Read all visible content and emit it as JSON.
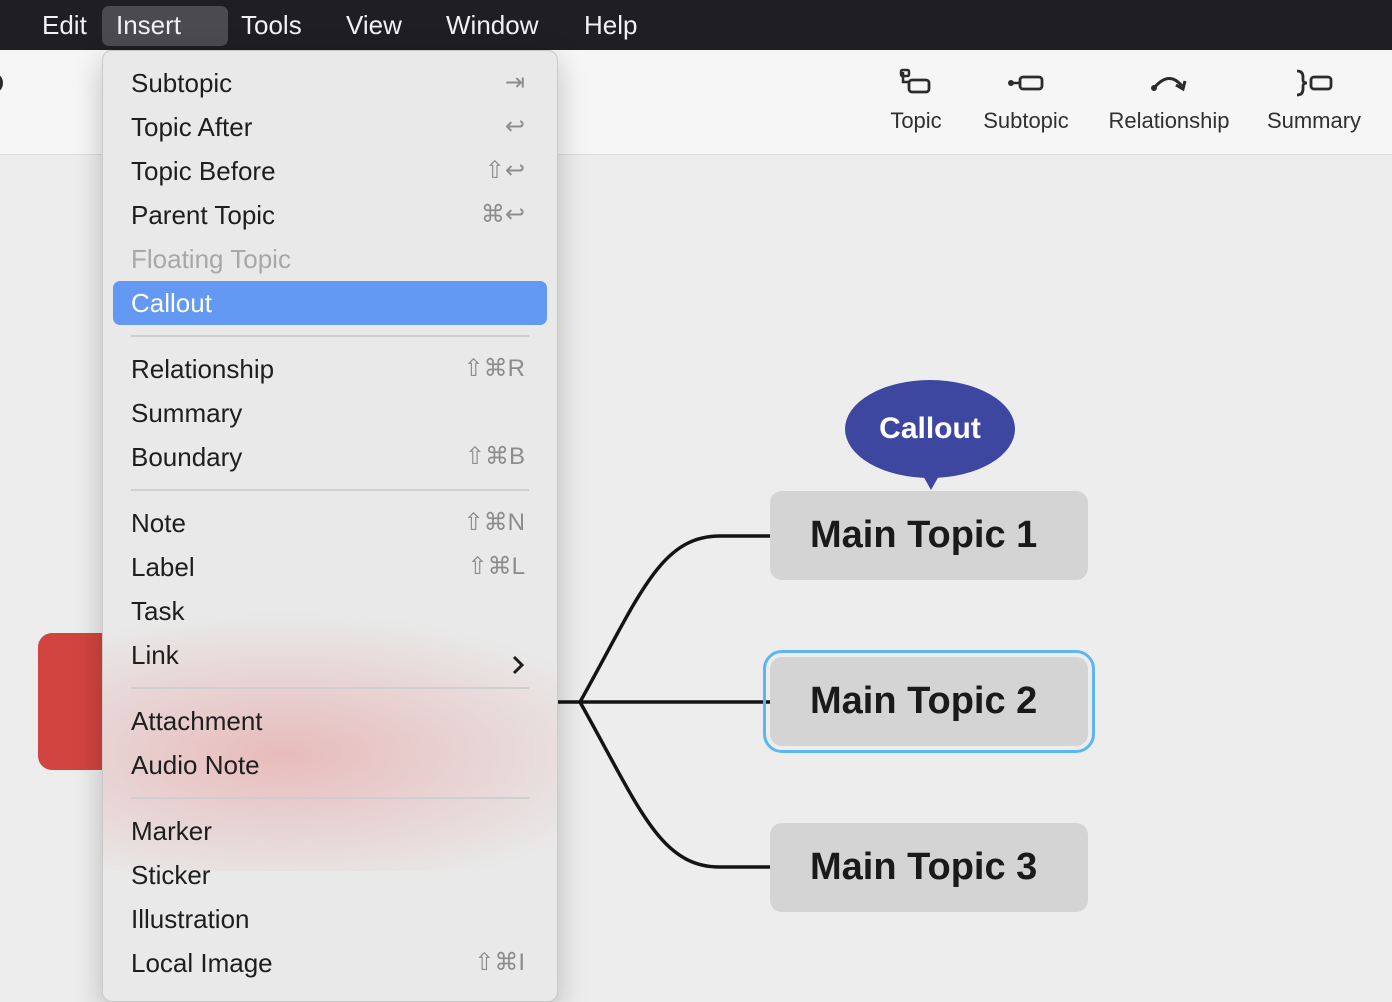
{
  "menubar": {
    "items": [
      {
        "label": "Edit",
        "active": false
      },
      {
        "label": "Insert",
        "active": true
      },
      {
        "label": "Tools",
        "active": false
      },
      {
        "label": "View",
        "active": false
      },
      {
        "label": "Window",
        "active": false
      },
      {
        "label": "Help",
        "active": false
      }
    ]
  },
  "toolbar": {
    "buttons": [
      {
        "label": "Topic",
        "icon": "insert-topic-icon"
      },
      {
        "label": "Subtopic",
        "icon": "insert-subtopic-icon"
      },
      {
        "label": "Relationship",
        "icon": "relationship-curve-icon"
      },
      {
        "label": "Summary",
        "icon": "summary-brace-icon"
      }
    ]
  },
  "insert_menu": {
    "items": [
      {
        "label": "Subtopic",
        "shortcut": "⇥"
      },
      {
        "label": "Topic After",
        "shortcut": "↩"
      },
      {
        "label": "Topic Before",
        "shortcut": "⇧↩"
      },
      {
        "label": "Parent Topic",
        "shortcut": "⌘↩"
      },
      {
        "label": "Floating Topic",
        "shortcut": "",
        "disabled": true
      },
      {
        "label": "Callout",
        "shortcut": "",
        "highlighted": true
      },
      {
        "label": "Relationship",
        "shortcut": "⇧⌘R"
      },
      {
        "label": "Summary",
        "shortcut": ""
      },
      {
        "label": "Boundary",
        "shortcut": "⇧⌘B"
      },
      {
        "label": "Note",
        "shortcut": "⇧⌘N"
      },
      {
        "label": "Label",
        "shortcut": "⇧⌘L"
      },
      {
        "label": "Task",
        "shortcut": ""
      },
      {
        "label": "Link",
        "shortcut": "",
        "submenu": true
      },
      {
        "label": "Attachment",
        "shortcut": ""
      },
      {
        "label": "Audio Note",
        "shortcut": ""
      },
      {
        "label": "Marker",
        "shortcut": ""
      },
      {
        "label": "Sticker",
        "shortcut": ""
      },
      {
        "label": "Illustration",
        "shortcut": ""
      },
      {
        "label": "Local Image",
        "shortcut": "⇧⌘I"
      }
    ]
  },
  "mindmap": {
    "callout": "Callout",
    "topics": [
      {
        "label": "Main Topic 1",
        "selected": false
      },
      {
        "label": "Main Topic 2",
        "selected": true
      },
      {
        "label": "Main Topic 3",
        "selected": false
      }
    ]
  },
  "colors": {
    "menubar_bg": "#1f1e23",
    "highlight": "#6399f2",
    "callout": "#3d479f",
    "central_topic": "#d2443f",
    "topic_bg": "#d4d4d4",
    "selection": "#5db5f2"
  }
}
